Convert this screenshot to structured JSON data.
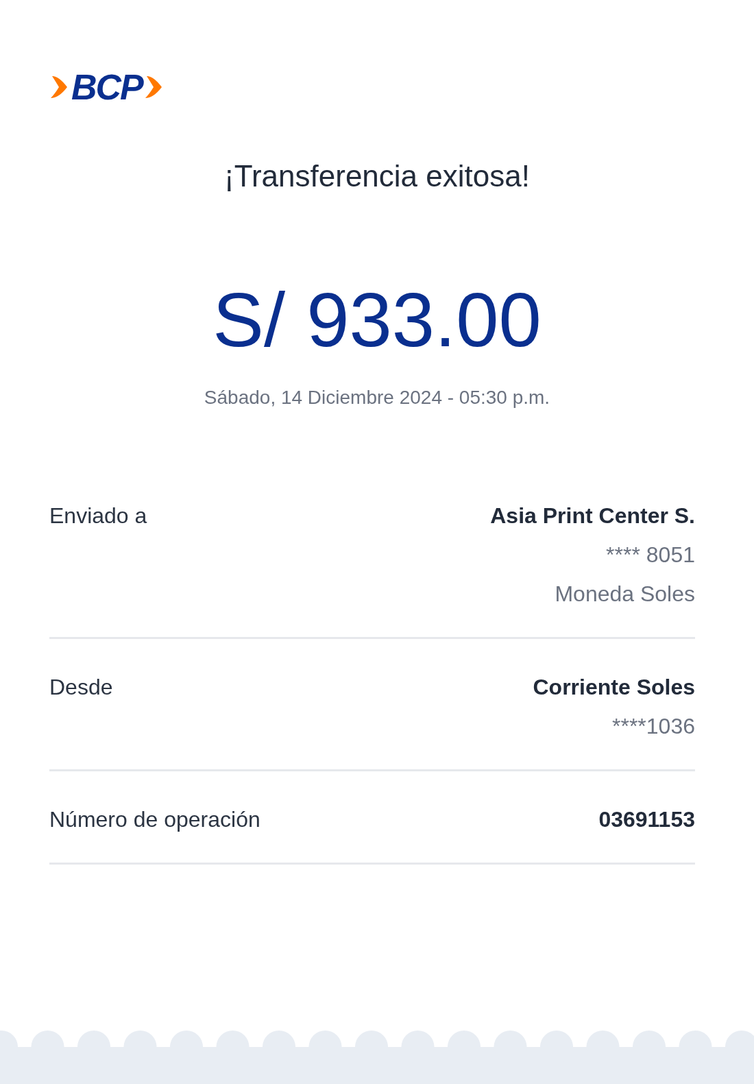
{
  "logo": {
    "text": "BCP"
  },
  "title": "¡Transferencia exitosa!",
  "amount": "S/ 933.00",
  "date": "Sábado, 14 Diciembre 2024 - 05:30 p.m.",
  "details": [
    {
      "label": "Enviado a",
      "values": [
        {
          "text": "Asia Print Center S.",
          "kind": "strong"
        },
        {
          "text": "**** 8051",
          "kind": "plain"
        },
        {
          "text": "Moneda Soles",
          "kind": "plain"
        }
      ]
    },
    {
      "label": "Desde",
      "values": [
        {
          "text": "Corriente Soles",
          "kind": "strong"
        },
        {
          "text": "****1036",
          "kind": "plain"
        }
      ]
    },
    {
      "label": "Número de operación",
      "values": [
        {
          "text": "03691153",
          "kind": "strong"
        }
      ]
    }
  ]
}
